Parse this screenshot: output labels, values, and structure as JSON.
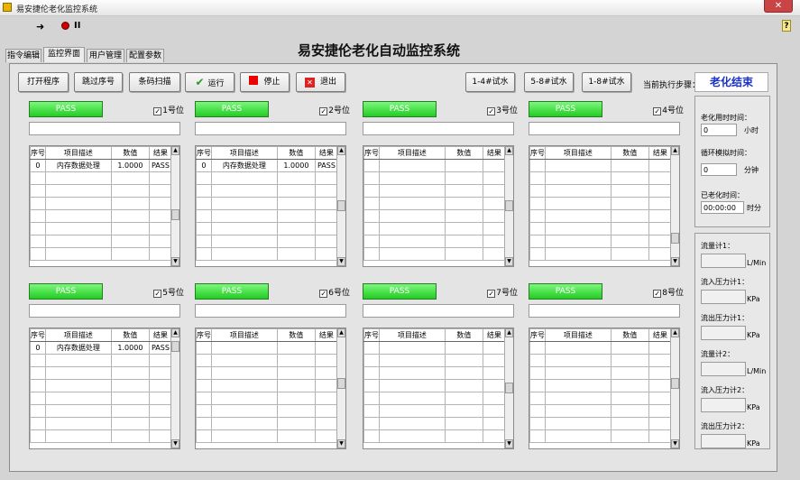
{
  "window": {
    "title": "易安捷伦老化监控系统",
    "close": "✕"
  },
  "toolbar": {
    "run_glyph": "➜",
    "pause_glyph": "II",
    "help_glyph": "?"
  },
  "tabs": [
    "指令编辑",
    "监控界面",
    "用户管理",
    "配置参数"
  ],
  "main_title": "易安捷伦老化自动监控系统",
  "buttons": {
    "open_program": "打开程序",
    "jump_step": "跳过序号",
    "barcode_scan": "条码扫描",
    "run": "运行",
    "stop": "停止",
    "exit": "退出",
    "pump_1_4": "1-4#试水",
    "pump_5_8": "5-8#试水",
    "pump_1_8": "1-8#试水"
  },
  "step_label": "当前执行步骤：",
  "status": "老化结束",
  "colors": {
    "pass": "#22cc22",
    "status_text": "#1a32c8"
  },
  "table_headers": [
    "序号",
    "项目描述",
    "数值",
    "结果"
  ],
  "stations": [
    {
      "pass": "PASS",
      "label": "1号位",
      "checked": "✓",
      "rows": [
        {
          "no": "0",
          "desc": "内存数据处理",
          "value": "1.0000",
          "result": "PASS"
        }
      ]
    },
    {
      "pass": "PASS",
      "label": "2号位",
      "checked": "✓",
      "rows": [
        {
          "no": "0",
          "desc": "内存数据处理",
          "value": "1.0000",
          "result": "PASS"
        }
      ]
    },
    {
      "pass": "PASS",
      "label": "3号位",
      "checked": "✓",
      "rows": []
    },
    {
      "pass": "PASS",
      "label": "4号位",
      "checked": "✓",
      "rows": []
    },
    {
      "pass": "PASS",
      "label": "5号位",
      "checked": "✓",
      "rows": [
        {
          "no": "0",
          "desc": "内存数据处理",
          "value": "1.0000",
          "result": "PASS"
        }
      ]
    },
    {
      "pass": "PASS",
      "label": "6号位",
      "checked": "✓",
      "rows": []
    },
    {
      "pass": "PASS",
      "label": "7号位",
      "checked": "✓",
      "rows": []
    },
    {
      "pass": "PASS",
      "label": "8号位",
      "checked": "✓",
      "rows": []
    }
  ],
  "aging": {
    "total_label": "老化用时时间：",
    "total_value": "0",
    "total_unit": "小时",
    "cycle_label": "循环模拟时间：",
    "cycle_value": "0",
    "cycle_unit": "分钟",
    "elapsed_label": "已老化时间：",
    "elapsed_value": "00:00:00",
    "elapsed_unit": "时分"
  },
  "sensors": [
    {
      "label": "流量计1：",
      "unit": "L/Min"
    },
    {
      "label": "流入压力计1：",
      "unit": "KPa"
    },
    {
      "label": "流出压力计1：",
      "unit": "KPa"
    },
    {
      "label": "流量计2：",
      "unit": "L/Min"
    },
    {
      "label": "流入压力计2：",
      "unit": "KPa"
    },
    {
      "label": "流出压力计2：",
      "unit": "KPa"
    }
  ]
}
